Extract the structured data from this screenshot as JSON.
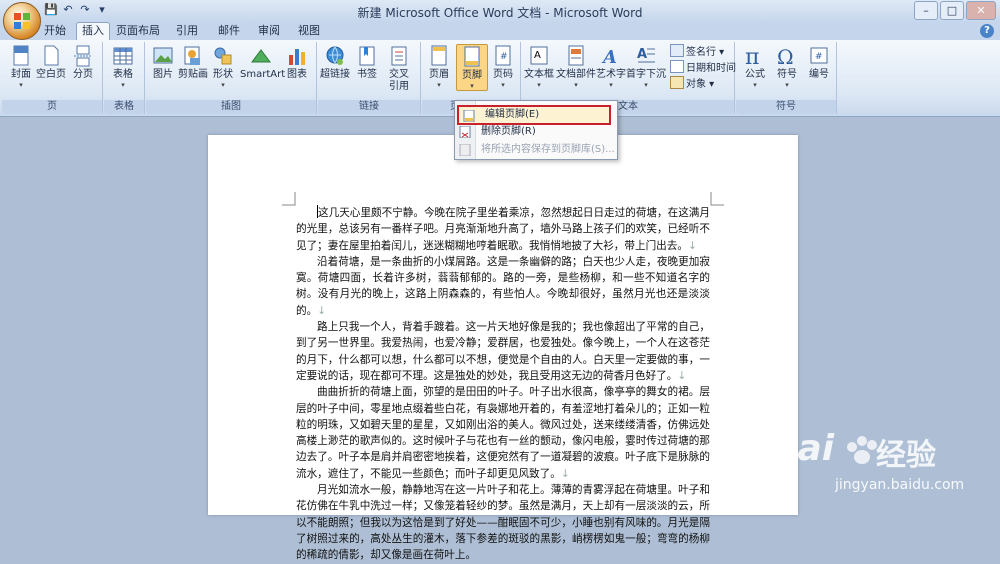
{
  "window": {
    "title": "新建 Microsoft Office Word 文档 - Microsoft Word",
    "controls": [
      "–",
      "□",
      "✕"
    ]
  },
  "qat": [
    "💾",
    "↶",
    "↷",
    "▾"
  ],
  "tabs": [
    "开始",
    "插入",
    "页面布局",
    "引用",
    "邮件",
    "审阅",
    "视图"
  ],
  "active_tab": "插入",
  "ribbon": {
    "groups": {
      "pages": {
        "label": "页",
        "buttons": [
          "封面",
          "空白页",
          "分页"
        ]
      },
      "tables": {
        "label": "表格",
        "buttons": [
          "表格"
        ]
      },
      "illustrations": {
        "label": "插图",
        "buttons": [
          "图片",
          "剪贴画",
          "形状",
          "SmartArt",
          "图表"
        ]
      },
      "links": {
        "label": "链接",
        "buttons": [
          "超链接",
          "书签",
          "交叉\n引用"
        ]
      },
      "header_footer": {
        "label": "页",
        "buttons": [
          "页眉",
          "页脚",
          "页码"
        ]
      },
      "text": {
        "label": "文本",
        "buttons": [
          "文本框",
          "文档部件",
          "艺术字",
          "首字下沉"
        ],
        "small": [
          "签名行",
          "日期和时间",
          "对象"
        ]
      },
      "symbols": {
        "label": "符号",
        "buttons": [
          "公式",
          "符号",
          "编号"
        ]
      }
    }
  },
  "footer_menu": {
    "items": [
      {
        "label": "编辑页脚(E)",
        "state": "highlighted"
      },
      {
        "label": "删除页脚(R)",
        "state": "normal"
      },
      {
        "label": "将所选内容保存到页脚库(S)...",
        "state": "disabled"
      }
    ]
  },
  "document": {
    "paragraphs": [
      "这几天心里颇不宁静。今晚在院子里坐着乘凉，忽然想起日日走过的荷塘，在这满月的光里，总该另有一番样子吧。月亮渐渐地升高了，墙外马路上孩子们的欢笑，已经听不见了；妻在屋里拍着闰儿，迷迷糊糊地哼着眠歌。我悄悄地披了大衫，带上门出去。",
      "沿着荷塘，是一条曲折的小煤屑路。这是一条幽僻的路；白天也少人走，夜晚更加寂寞。荷塘四面，长着许多树，蓊蓊郁郁的。路的一旁，是些杨柳，和一些不知道名字的树。没有月光的晚上，这路上阴森森的，有些怕人。今晚却很好，虽然月光也还是淡淡的。",
      "路上只我一个人，背着手踱着。这一片天地好像是我的；我也像超出了平常的自己，到了另一世界里。我爱热闹，也爱冷静；爱群居，也爱独处。像今晚上，一个人在这苍茫的月下，什么都可以想，什么都可以不想，便觉是个自由的人。白天里一定要做的事，一定要说的话，现在都可不理。这是独处的妙处，我且受用这无边的荷香月色好了。",
      "曲曲折折的荷塘上面，弥望的是田田的叶子。叶子出水很高，像亭亭的舞女的裙。层层的叶子中间，零星地点缀着些白花，有袅娜地开着的，有羞涩地打着朵儿的；正如一粒粒的明珠，又如碧天里的星星，又如刚出浴的美人。微风过处，送来缕缕清香，仿佛远处高楼上渺茫的歌声似的。这时候叶子与花也有一丝的颤动，像闪电般，霎时传过荷塘的那边去了。叶子本是肩并肩密密地挨着，这便宛然有了一道凝碧的波痕。叶子底下是脉脉的流水，遮住了，不能见一些颜色；而叶子却更见风致了。",
      "月光如流水一般，静静地泻在这一片叶子和花上。薄薄的青雾浮起在荷塘里。叶子和花仿佛在牛乳中洗过一样；又像笼着轻纱的梦。虽然是满月，天上却有一层淡淡的云，所以不能朗照；但我以为这恰是到了好处——酣眠固不可少，小睡也别有风味的。月光是隔了树照过来的，高处丛生的灌木，落下参差的斑驳的黑影，峭楞楞如鬼一般；弯弯的杨柳的稀疏的倩影，却又像是画在荷叶上。"
    ],
    "para_mark": "↓"
  },
  "watermark": {
    "brand": "Bai",
    "brand_cn": "经验",
    "url": "jingyan.baidu.com"
  },
  "colors": {
    "highlight_border": "#c8202c",
    "pressed": "#fbd687"
  }
}
